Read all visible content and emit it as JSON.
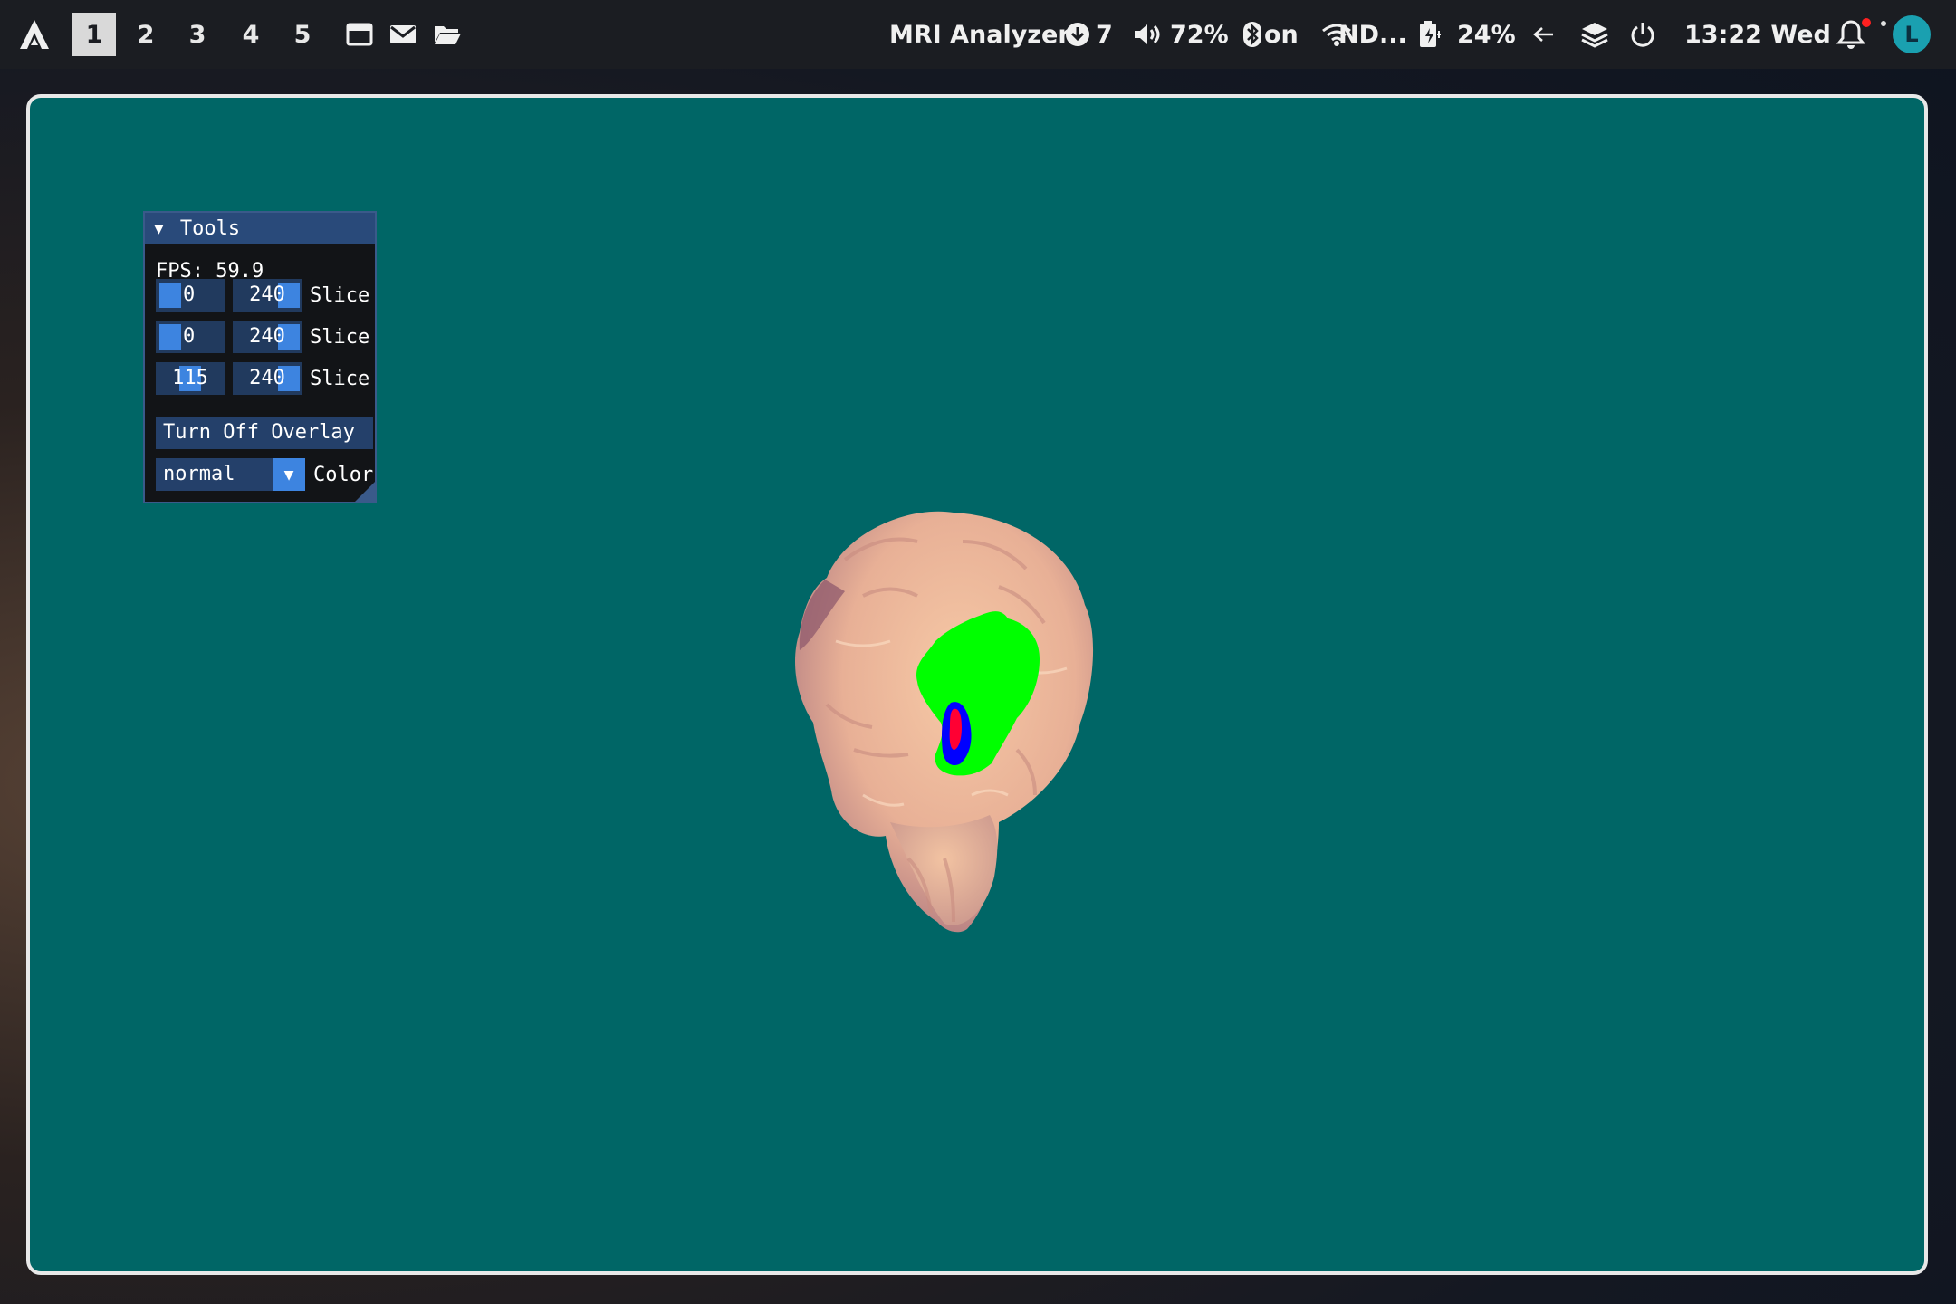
{
  "taskbar": {
    "workspaces": [
      "1",
      "2",
      "3",
      "4",
      "5"
    ],
    "active_workspace": "1",
    "app_title": "MRI Analyzer",
    "updates": "7",
    "volume": "72%",
    "bluetooth": "on",
    "network": "ND...",
    "battery": "24%",
    "clock": "13:22 Wed",
    "avatar_letter": "L"
  },
  "tools_panel": {
    "title": "Tools",
    "fps": "FPS: 59.9",
    "rows": [
      {
        "min": "0",
        "max": "240",
        "label": "Slice"
      },
      {
        "min": "0",
        "max": "240",
        "label": "Slice"
      },
      {
        "min": "115",
        "max": "240",
        "label": "Slice"
      }
    ],
    "overlay_button": "Turn Off Overlay",
    "colormap": "normal",
    "colormap_label": "Color"
  },
  "colors": {
    "viewport_bg": "#006666",
    "panel_header": "#294a7a",
    "slider_grab": "#3d84e0",
    "overlay_green": "#00ff00",
    "overlay_blue": "#0000ff",
    "overlay_red": "#ff0033"
  }
}
